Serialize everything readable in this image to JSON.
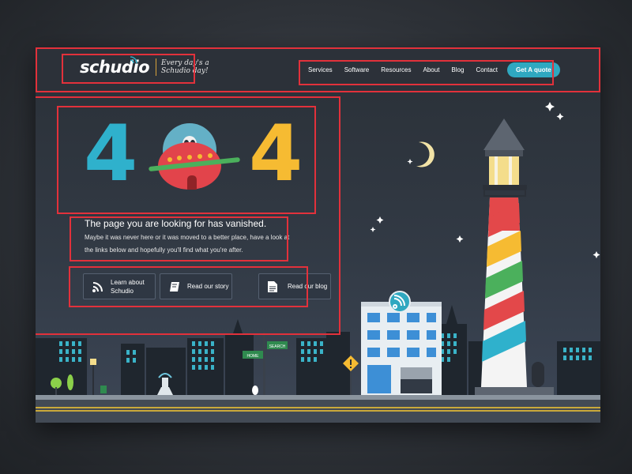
{
  "header": {
    "logo_text": "schudio",
    "tagline": "Every day's a Schudio day!",
    "nav": [
      "Services",
      "Software",
      "Resources",
      "About",
      "Blog",
      "Contact"
    ],
    "cta_label": "Get A quote"
  },
  "error": {
    "code_left": "4",
    "code_right": "4",
    "title": "The page you are looking for has vanished.",
    "body": "Maybe it was never here or it was moved to a better place, have a look at the links below and hopefully you'll find what you're after."
  },
  "links": [
    {
      "label": "Learn about Schudio",
      "icon": "wifi-icon"
    },
    {
      "label": "Read our story",
      "icon": "book-icon"
    },
    {
      "label": "Read our blog",
      "icon": "document-icon"
    }
  ],
  "signs": {
    "home": "HOME",
    "search": "SEARCH"
  },
  "colors": {
    "accent": "#2fa8c0",
    "four_left": "#2fb1cc",
    "four_right": "#f6bb32",
    "annotation": "#e2313b",
    "ufo": "#e2444b"
  }
}
